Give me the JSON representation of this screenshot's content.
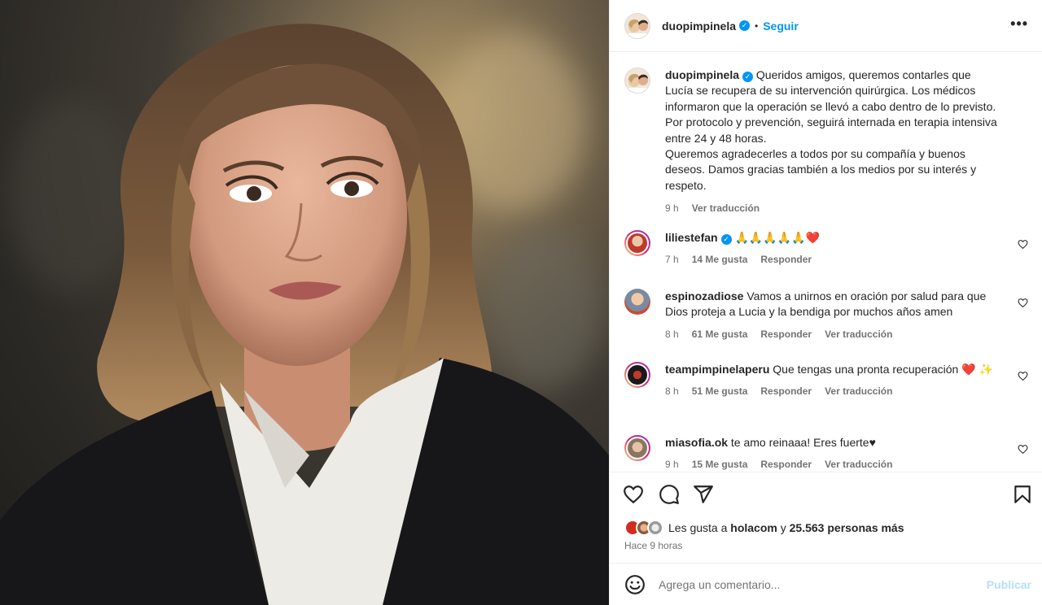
{
  "post": {
    "username": "duopimpinela",
    "follow_label": "Seguir",
    "separator": "•",
    "more_label": "•••"
  },
  "caption": {
    "username": "duopimpinela",
    "text": "Queridos amigos, queremos contarles que Lucía se recupera de su intervención quirúrgica. Los médicos informaron que la operación se llevó a cabo dentro de lo previsto. Por protocolo y prevención, seguirá internada en terapia intensiva entre 24 y 48 horas.",
    "text2": "Queremos agradecerles a todos por su compañía y buenos deseos. Damos gracias también a los medios por su interés y respeto.",
    "time": "9 h",
    "translate": "Ver traducción"
  },
  "comments": [
    {
      "username": "liliestefan",
      "verified": true,
      "text": "🙏🙏🙏🙏🙏❤️",
      "time": "7 h",
      "likes": "14 Me gusta",
      "reply": "Responder",
      "translate": ""
    },
    {
      "username": "espinozadiose",
      "verified": false,
      "text": "Vamos a unirnos en oración por salud para que Dios proteja a Lucia y la bendiga por muchos años amen",
      "time": "8 h",
      "likes": "61 Me gusta",
      "reply": "Responder",
      "translate": "Ver traducción"
    },
    {
      "username": "teampimpinelaperu",
      "verified": false,
      "text": "Que tengas una pronta recuperación ❤️ ✨",
      "time": "8 h",
      "likes": "51 Me gusta",
      "reply": "Responder",
      "translate": "Ver traducción"
    },
    {
      "username": "miasofia.ok",
      "verified": false,
      "text": "te amo reinaaa! Eres fuerte♥",
      "time": "9 h",
      "likes": "15 Me gusta",
      "reply": "Responder",
      "translate": "Ver traducción"
    }
  ],
  "likes": {
    "prefix": "Les gusta a",
    "user": "holacom",
    "connector": "y",
    "count": "25.563 personas más"
  },
  "posted_ago": "Hace 9 horas",
  "composer": {
    "placeholder": "Agrega un comentario...",
    "publish_label": "Publicar"
  },
  "colors": {
    "accent": "#0095f6",
    "publish_disabled": "#b2dffc",
    "secondary_text": "#737373",
    "like_red": "#ed4956"
  }
}
